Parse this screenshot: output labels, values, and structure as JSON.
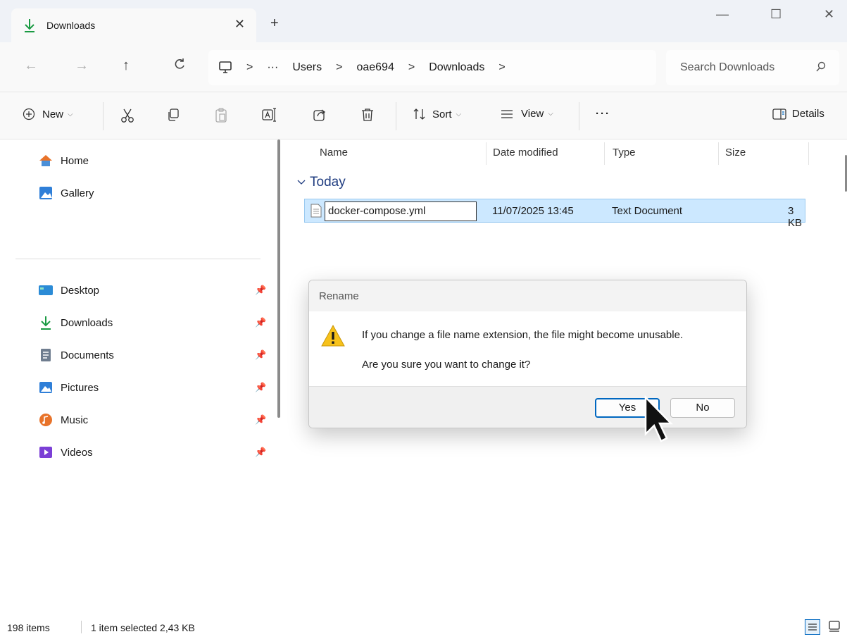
{
  "window": {
    "tab_title": "Downloads",
    "tab_close": "✕",
    "new_tab": "+",
    "minimize": "—",
    "maximize": "☐",
    "close": "✕"
  },
  "nav": {
    "back": "←",
    "forward": "→",
    "up": "↑",
    "refresh": "C",
    "breadcrumb": [
      "Users",
      "oae694",
      "Downloads"
    ],
    "ellipsis": "···",
    "separator": ">",
    "search_placeholder": "Search Downloads"
  },
  "commands": {
    "new_label": "New",
    "sort_label": "Sort",
    "view_label": "View",
    "more_label": "···",
    "details_label": "Details"
  },
  "sidebar": {
    "top_items": [
      {
        "label": "Home",
        "icon": "home-icon"
      },
      {
        "label": "Gallery",
        "icon": "gallery-icon"
      }
    ],
    "pinned_items": [
      {
        "label": "Desktop",
        "icon": "desktop-icon"
      },
      {
        "label": "Downloads",
        "icon": "downloads-icon"
      },
      {
        "label": "Documents",
        "icon": "documents-icon"
      },
      {
        "label": "Pictures",
        "icon": "pictures-icon"
      },
      {
        "label": "Music",
        "icon": "music-icon"
      },
      {
        "label": "Videos",
        "icon": "videos-icon"
      }
    ],
    "pin_glyph": "📌"
  },
  "filelist": {
    "columns": [
      "Name",
      "Date modified",
      "Type",
      "Size"
    ],
    "group_label": "Today",
    "selected_file": {
      "name": "docker-compose.yml",
      "date_modified": "11/07/2025 13:45",
      "type": "Text Document",
      "size": "3 KB"
    }
  },
  "dialog": {
    "title": "Rename",
    "message": "If you change a file name extension, the file might become unusable.",
    "question": "Are you sure you want to change it?",
    "yes_label": "Yes",
    "no_label": "No"
  },
  "status": {
    "item_count": "198 items",
    "selection": "1 item selected  2,43 KB"
  },
  "colors": {
    "accent": "#0067c0",
    "selection_bg": "#cce8ff",
    "group_text": "#1f3c80",
    "warning": "#f7c21b"
  }
}
